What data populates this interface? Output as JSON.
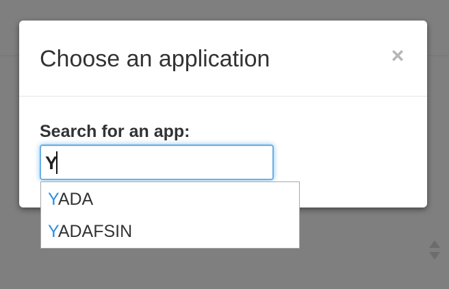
{
  "dialog": {
    "title": "Choose an application",
    "close_label": "×"
  },
  "search": {
    "label": "Search for an app:",
    "value": "Y"
  },
  "suggestions": [
    {
      "match": "Y",
      "rest": "ADA"
    },
    {
      "match": "Y",
      "rest": "ADAFSIN"
    }
  ],
  "colors": {
    "overlay": "#7f7f7f",
    "match_highlight": "#2b8fe0",
    "focus_ring": "#66afe9"
  }
}
